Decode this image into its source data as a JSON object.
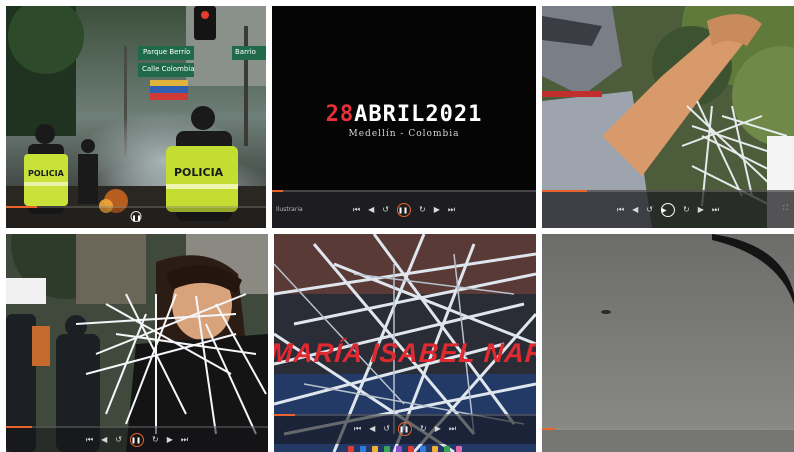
{
  "tiles": [
    {
      "scene": "street-protest-police",
      "sign_top": "Parque Berrío",
      "sign_bottom": "Calle Colombia",
      "sign_right": "Barrio",
      "vest_left": "POLICIA",
      "vest_right": "POLICIA",
      "progress": 0.12
    },
    {
      "scene": "title-card",
      "title_number": "28",
      "title_word": "ABRIL2021",
      "subtitle": "Medellín - Colombia",
      "bar_label": "Ilustraria",
      "progress": 0.04
    },
    {
      "scene": "raised-fist-zip-ties",
      "progress": 0.18
    },
    {
      "scene": "woman-zip-tie-mask",
      "progress": 0.1
    },
    {
      "scene": "zip-tie-sculpture",
      "name_banner": "MARÍA ISABEL NARAN",
      "progress": 0.08
    },
    {
      "scene": "overcast-sky-bird",
      "progress": 0.05
    }
  ],
  "controls": {
    "prev_icon": "skip-back-icon",
    "rewind_icon": "rewind-icon",
    "replay_icon": "replay-icon",
    "play_pause_icon": "pause-icon",
    "forward_icon": "forward-icon",
    "next_icon": "skip-forward-icon"
  },
  "colors": {
    "accent_orange": "#e8642c",
    "title_red": "#e6303a",
    "banner_red": "#e02a31"
  }
}
